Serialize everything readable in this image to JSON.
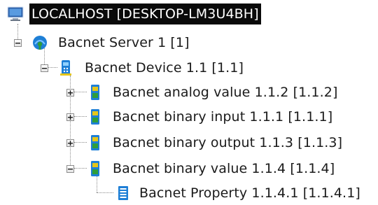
{
  "tree": {
    "root": {
      "label": "LOCALHOST [DESKTOP-LM3U4BH]",
      "icon": "computer-monitor-icon",
      "selected": true
    },
    "server": {
      "label": "Bacnet Server 1 [1]",
      "icon": "bacnet-server-icon",
      "expanded": true
    },
    "device": {
      "label": "Bacnet Device 1.1 [1.1]",
      "icon": "bacnet-device-icon",
      "expanded": true
    },
    "objects": [
      {
        "label": "Bacnet analog value 1.1.2 [1.1.2]",
        "icon": "bacnet-object-icon",
        "expanded": false
      },
      {
        "label": "Bacnet binary input 1.1.1 [1.1.1]",
        "icon": "bacnet-object-icon",
        "expanded": false
      },
      {
        "label": "Bacnet binary output 1.1.3 [1.1.3]",
        "icon": "bacnet-object-icon",
        "expanded": false
      },
      {
        "label": "Bacnet binary value 1.1.4 [1.1.4]",
        "icon": "bacnet-object-icon",
        "expanded": true
      }
    ],
    "property": {
      "label": "Bacnet Property 1.1.4.1 [1.1.4.1]",
      "icon": "bacnet-property-icon"
    }
  },
  "colors": {
    "selection_bg": "#0a0a0a",
    "selection_text": "#ffffff",
    "text": "#1a1a1a",
    "icon_blue": "#1e7fd6",
    "icon_green": "#2e9e3a",
    "icon_yellow": "#e6c619"
  }
}
